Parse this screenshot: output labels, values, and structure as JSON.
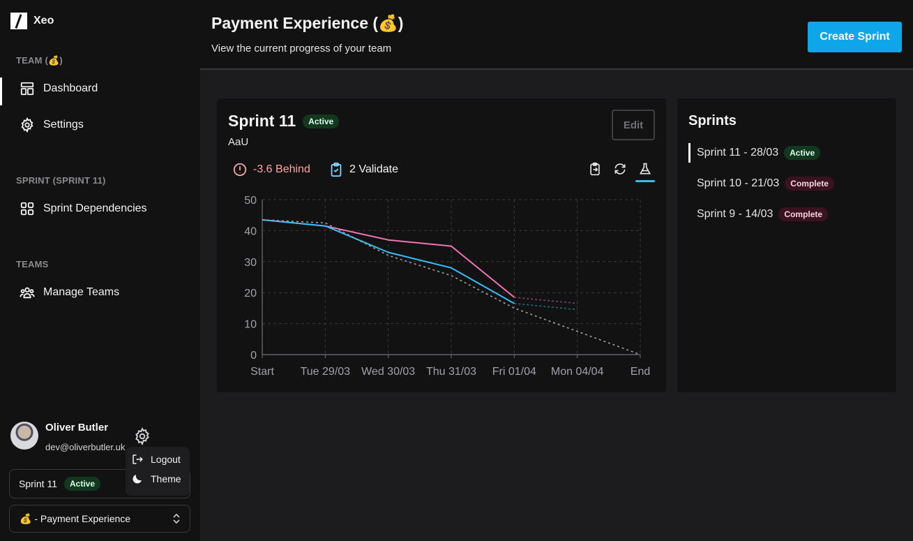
{
  "app": {
    "name": "Xeo"
  },
  "sidebar": {
    "team_label": "TEAM (💰)",
    "team_items": [
      {
        "label": "Dashboard",
        "icon": "layout-dashboard-icon",
        "active": true
      },
      {
        "label": "Settings",
        "icon": "gear-icon"
      }
    ],
    "sprint_label": "SPRINT (SPRINT 11)",
    "sprint_items": [
      {
        "label": "Sprint Dependencies",
        "icon": "grid-icon"
      }
    ],
    "teams_label": "TEAMS",
    "teams_items": [
      {
        "label": "Manage Teams",
        "icon": "users-icon"
      }
    ],
    "user": {
      "name": "Oliver Butler",
      "email": "dev@oliverbutler.uk"
    },
    "menu": {
      "logout": "Logout",
      "theme": "Theme"
    },
    "sprint_select": {
      "label": "Sprint 11",
      "badge": "Active"
    },
    "team_select": {
      "label": "💰 - Payment Experience"
    }
  },
  "header": {
    "title": "Payment Experience (💰)",
    "subtitle": "View the current progress of your team",
    "create_button": "Create Sprint"
  },
  "sprint": {
    "title": "Sprint 11",
    "badge": "Active",
    "subtitle": "AaU",
    "edit_label": "Edit",
    "behind": "-3.6 Behind",
    "validate": "2 Validate"
  },
  "colors": {
    "accent": "#0ea5e9",
    "behind": "#fca5a5",
    "pink": "#f472b6",
    "blue": "#38bdf8",
    "ideal": "#a1a1aa"
  },
  "chart_data": {
    "type": "line",
    "categories": [
      "Start",
      "Tue 29/03",
      "Wed 30/03",
      "Thu 31/03",
      "Fri 01/04",
      "Mon 04/04",
      "End"
    ],
    "yticks": [
      0,
      10,
      20,
      30,
      40,
      50
    ],
    "ylim": [
      0,
      50
    ],
    "grid": true,
    "legend": "none",
    "series": [
      {
        "values": [
          43.5,
          41.5,
          37,
          35,
          18.5,
          null,
          null
        ],
        "color": "#f472b6",
        "style": "solid"
      },
      {
        "values": [
          null,
          null,
          null,
          null,
          18.5,
          16.5,
          null
        ],
        "color": "#f472b6",
        "style": "dotted-faded"
      },
      {
        "values": [
          43.5,
          41.5,
          33,
          28,
          16.5,
          null,
          null
        ],
        "color": "#38bdf8",
        "style": "solid"
      },
      {
        "values": [
          null,
          null,
          null,
          null,
          16.5,
          14.5,
          null
        ],
        "color": "#38bdf8",
        "style": "dotted-faded"
      },
      {
        "values": [
          43.5,
          42.5,
          32,
          25.5,
          15,
          7.5,
          0
        ],
        "color": "#a1a1aa",
        "style": "dotted"
      }
    ]
  },
  "sprints_panel": {
    "title": "Sprints",
    "items": [
      {
        "label": "Sprint 11 - 28/03",
        "status": "Active",
        "current": true
      },
      {
        "label": "Sprint 10 - 21/03",
        "status": "Complete"
      },
      {
        "label": "Sprint 9 - 14/03",
        "status": "Complete"
      }
    ]
  }
}
